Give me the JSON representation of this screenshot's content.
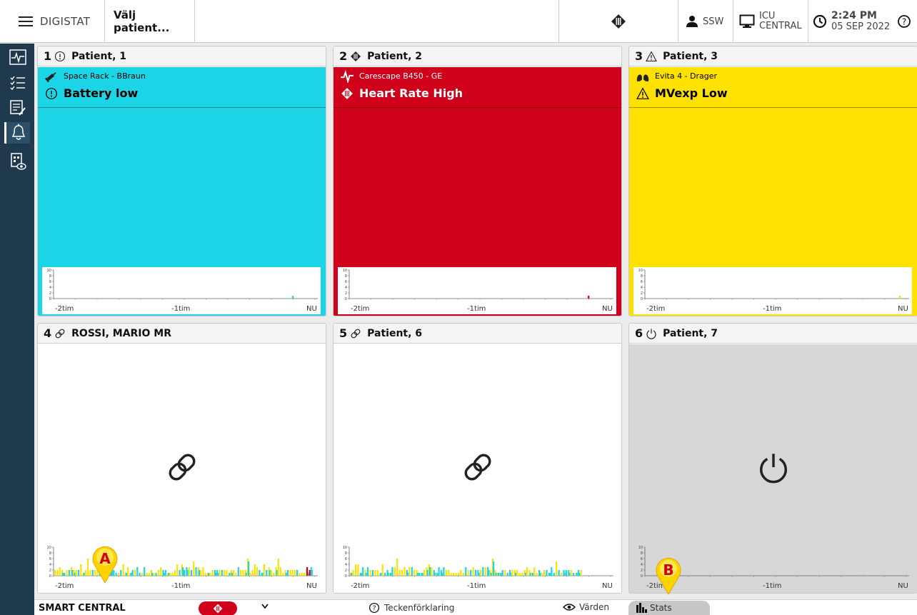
{
  "topbar": {
    "app_name": "DIGISTAT",
    "patient_selector": "Välj patient...",
    "user": "SSW",
    "workstation_line1": "ICU",
    "workstation_line2": "CENTRAL",
    "time": "2:24 PM",
    "date": "05 SEP 2022"
  },
  "sidebar": {
    "items": [
      {
        "icon": "monitor-wave-icon"
      },
      {
        "icon": "checklist-icon"
      },
      {
        "icon": "notes-icon"
      },
      {
        "icon": "bell-icon",
        "active": true
      },
      {
        "icon": "bed-eye-icon"
      }
    ]
  },
  "tiles": [
    {
      "number": "1",
      "status_icon": "info-circle-icon",
      "patient": "Patient, 1",
      "state": "alarm",
      "color": "#1bd5e6",
      "device": "Space Rack - BBraun",
      "device_icon": "syringe-icon",
      "alarm_icon": "info-circle-icon",
      "alarm_text": "Battery low",
      "text_color": "#000000",
      "bars": [
        {
          "pos": 0.92,
          "value": 1,
          "color": "#1bd5e6"
        }
      ]
    },
    {
      "number": "2",
      "status_icon": "alarm-diamond-icon",
      "patient": "Patient, 2",
      "state": "alarm",
      "color": "#d0021b",
      "device": "Carescape B450 - GE",
      "device_icon": "heart-wave-icon",
      "alarm_icon": "alarm-diamond-icon",
      "alarm_text": "Heart Rate High",
      "text_color": "#ffffff",
      "bars": [
        {
          "pos": 0.92,
          "value": 1,
          "color": "#d0021b"
        }
      ]
    },
    {
      "number": "3",
      "status_icon": "warning-triangle-icon",
      "patient": "Patient, 3",
      "state": "alarm",
      "color": "#ffe100",
      "device": "Evita 4 - Drager",
      "device_icon": "lungs-icon",
      "alarm_icon": "warning-triangle-icon",
      "alarm_text": "MVexp Low",
      "text_color": "#000000",
      "bars": [
        {
          "pos": 0.98,
          "value": 1,
          "color": "#ffe100"
        }
      ]
    },
    {
      "number": "4",
      "status_icon": "link-icon",
      "patient": "ROSSI, MARIO MR",
      "state": "linked",
      "color": "#ffffff",
      "center_icon": "link-icon",
      "dense": true,
      "seed": 7
    },
    {
      "number": "5",
      "status_icon": "link-icon",
      "patient": "Patient, 6",
      "state": "linked",
      "color": "#ffffff",
      "center_icon": "link-icon",
      "dense": true,
      "seed": 3
    },
    {
      "number": "6",
      "status_icon": "power-icon",
      "patient": "Patient, 7",
      "state": "off",
      "color": "#d7d7d7",
      "center_icon": "power-icon",
      "dense": false
    }
  ],
  "sparkline": {
    "y_ticks": [
      "10",
      "8",
      "6",
      "4",
      "2",
      "0"
    ],
    "x_labels": [
      "-2tim",
      "-1tim",
      "NU"
    ]
  },
  "bottombar": {
    "title": "SMART CENTRAL",
    "legend_label": "Teckenförklaring",
    "values_label": "Värden",
    "stats_label": "Stats"
  },
  "callouts": [
    {
      "label": "A"
    },
    {
      "label": "B"
    }
  ]
}
